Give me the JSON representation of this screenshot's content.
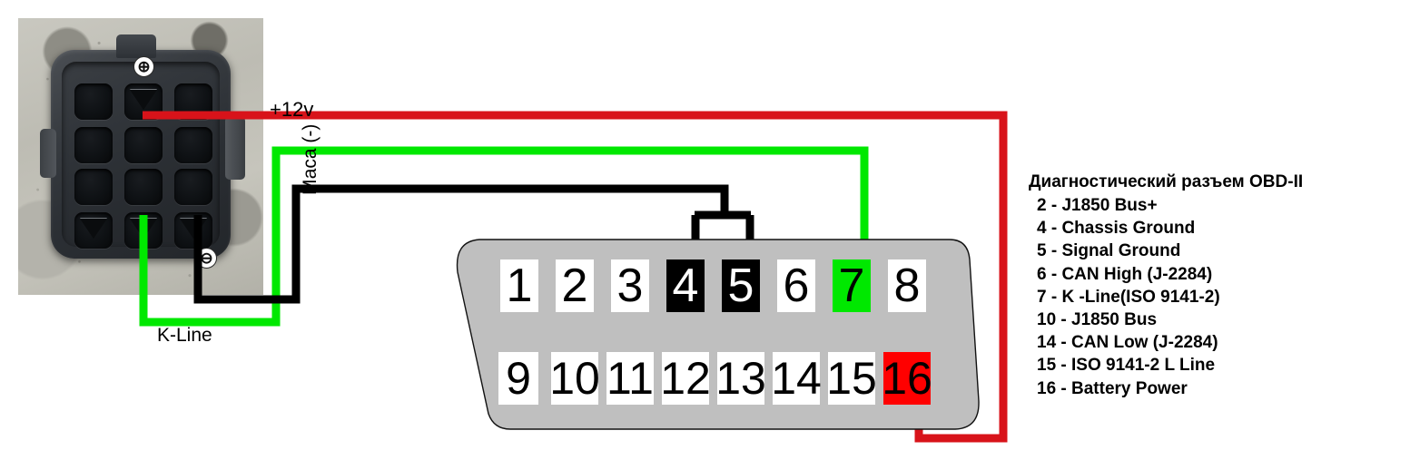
{
  "diagram": {
    "title_hidden": "",
    "photo": {
      "name": "vehicle-diagnostic-connector-photo",
      "plus_symbol": "⊕",
      "minus_symbol": "⊖",
      "socket_count": 12
    },
    "wire_labels": {
      "power": "+12v",
      "ground": "Маса (-)",
      "kline": "K-Line"
    },
    "wires": [
      {
        "id": "power-wire",
        "color": "#d8131a",
        "from": "connector-pin-top-middle",
        "to": "obd-pin-16"
      },
      {
        "id": "kline-wire",
        "color": "#00e800",
        "from": "connector-pin-bottom-middle",
        "to": "obd-pin-7"
      },
      {
        "id": "ground-wire",
        "color": "#000000",
        "from": "connector-pin-bottom-right",
        "to": "obd-pin-4 / obd-pin-5"
      }
    ]
  },
  "obd": {
    "name": "obd-ii-connector",
    "body_color": "#bfbfbf",
    "pins_top": [
      {
        "num": "1",
        "state": "normal"
      },
      {
        "num": "2",
        "state": "normal"
      },
      {
        "num": "3",
        "state": "normal"
      },
      {
        "num": "4",
        "state": "black"
      },
      {
        "num": "5",
        "state": "black"
      },
      {
        "num": "6",
        "state": "normal"
      },
      {
        "num": "7",
        "state": "green"
      },
      {
        "num": "8",
        "state": "normal"
      }
    ],
    "pins_bottom": [
      {
        "num": "9",
        "state": "normal"
      },
      {
        "num": "10",
        "state": "normal"
      },
      {
        "num": "11",
        "state": "normal"
      },
      {
        "num": "12",
        "state": "normal"
      },
      {
        "num": "13",
        "state": "normal"
      },
      {
        "num": "14",
        "state": "normal"
      },
      {
        "num": "15",
        "state": "normal"
      },
      {
        "num": "16",
        "state": "red"
      }
    ]
  },
  "legend": {
    "title": "Диагностический разъем OBD-II",
    "rows": [
      "2 - J1850 Bus+",
      "4 - Chassis Ground",
      "5 - Signal Ground",
      "6 - CAN High (J-2284)",
      "7 -  K -Line(ISO 9141-2)",
      "10 - J1850 Bus",
      "14 - CAN Low (J-2284)",
      "15 - ISO 9141-2 L Line",
      "16 - Battery Power"
    ]
  },
  "colors": {
    "red": "#d8131a",
    "green": "#00e800",
    "black": "#000000",
    "connector_gray": "#bfbfbf"
  }
}
